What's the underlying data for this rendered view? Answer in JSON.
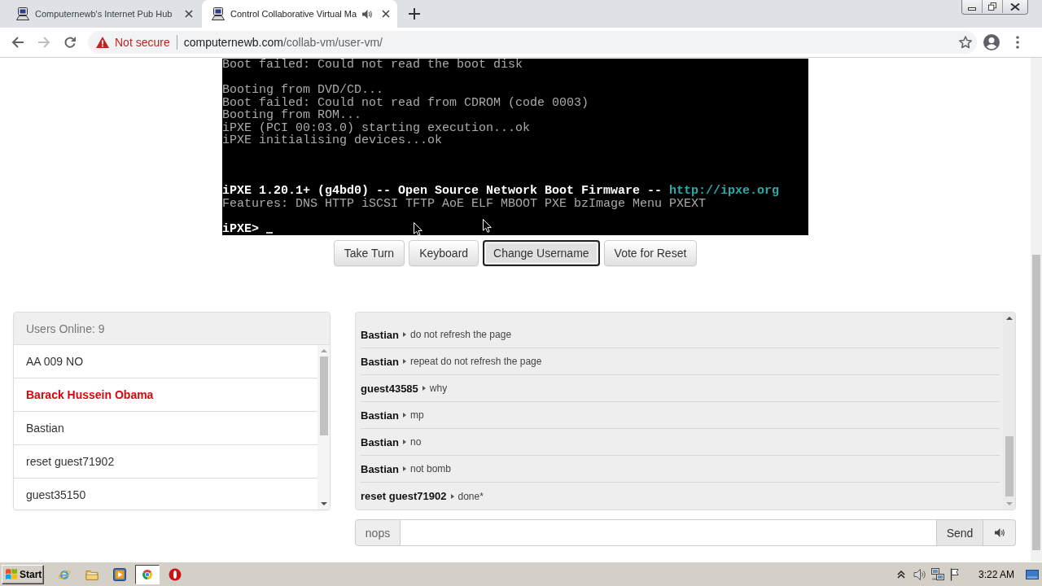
{
  "browser": {
    "tabs": [
      {
        "title": "Computernewb's Internet Pub Hub",
        "selected": false,
        "audio": false
      },
      {
        "title": "Control Collaborative Virtual Ma",
        "selected": true,
        "audio": true
      }
    ],
    "toolbar": {
      "back": {
        "disabled": false
      },
      "forward": {
        "disabled": true
      },
      "security_label": "Not secure",
      "url_host": "computernewb.com",
      "url_path": "/collab-vm/user-vm/"
    }
  },
  "vm_screen": {
    "lines": [
      {
        "kind": "plain",
        "text": "Boot failed: Could not read the boot disk"
      },
      {
        "kind": "blank"
      },
      {
        "kind": "plain",
        "text": "Booting from DVD/CD..."
      },
      {
        "kind": "plain",
        "text": "Boot failed: Could not read from CDROM (code 0003)"
      },
      {
        "kind": "plain",
        "text": "Booting from ROM..."
      },
      {
        "kind": "plain",
        "text": "iPXE (PCI 00:03.0) starting execution...ok"
      },
      {
        "kind": "plain",
        "text": "iPXE initialising devices...ok"
      },
      {
        "kind": "blank"
      },
      {
        "kind": "blank"
      },
      {
        "kind": "blank"
      },
      {
        "kind": "banner",
        "segments": [
          {
            "kind": "bright",
            "text": "iPXE 1.20.1+ (g4bd0) -- Open Source Network Boot Firmware -- "
          },
          {
            "kind": "link",
            "text": "http://ipxe.org"
          }
        ]
      },
      {
        "kind": "plain",
        "text": "Features: DNS HTTP iSCSI TFTP AoE ELF MBOOT PXE bzImage Menu PXEXT"
      },
      {
        "kind": "blank"
      },
      {
        "kind": "prompt",
        "text": "iPXE>"
      }
    ]
  },
  "vm_buttons": [
    {
      "label": "Take Turn",
      "focused": false
    },
    {
      "label": "Keyboard",
      "focused": false
    },
    {
      "label": "Change Username",
      "focused": true
    },
    {
      "label": "Vote for Reset",
      "focused": false
    }
  ],
  "users_panel": {
    "title": "Users Online: 9",
    "users": [
      {
        "name": "AA 009 NO",
        "highlighted": false
      },
      {
        "name": "Barack Hussein Obama",
        "highlighted": true
      },
      {
        "name": "Bastian",
        "highlighted": false
      },
      {
        "name": "reset guest71902",
        "highlighted": false
      },
      {
        "name": "guest35150",
        "highlighted": false
      }
    ]
  },
  "chat": {
    "messages": [
      {
        "user": "Bastian",
        "text": "do not refresh the page"
      },
      {
        "user": "Bastian",
        "text": "repeat do not refresh the page"
      },
      {
        "user": "guest43585",
        "text": "why"
      },
      {
        "user": "Bastian",
        "text": "mp"
      },
      {
        "user": "Bastian",
        "text": "no"
      },
      {
        "user": "Bastian",
        "text": "not bomb"
      },
      {
        "user": "reset guest71902",
        "text": "done*"
      }
    ],
    "username": "nops",
    "send_label": "Send"
  },
  "taskbar": {
    "start_label": "Start",
    "apps": [
      {
        "kind": "globe",
        "active": false
      },
      {
        "kind": "folder",
        "active": false
      },
      {
        "kind": "player",
        "active": false
      },
      {
        "kind": "browser",
        "active": true
      },
      {
        "kind": "ring",
        "active": false
      }
    ],
    "clock": "3:22 AM"
  }
}
